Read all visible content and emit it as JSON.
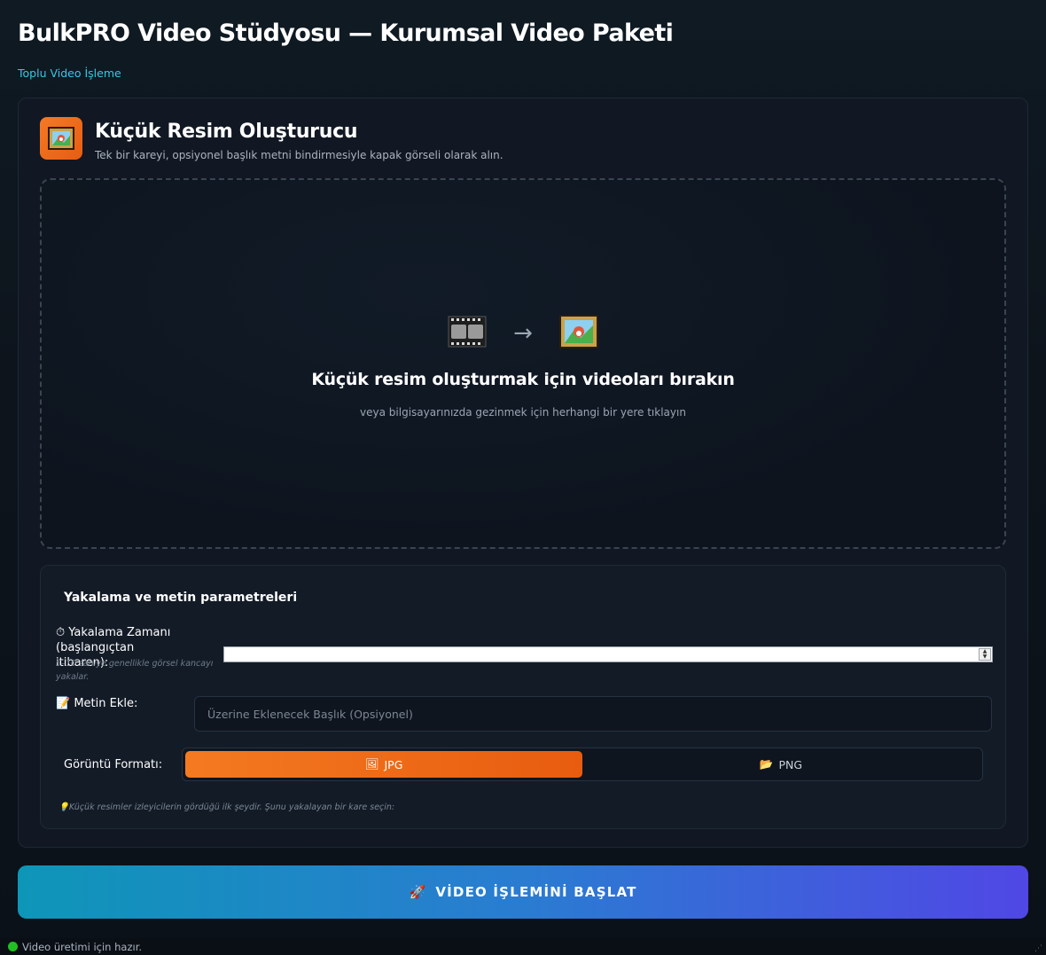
{
  "app": {
    "title": "BulkPRO Video Stüdyosu — Kurumsal Video Paketi",
    "subtitle": "Toplu Video İşleme"
  },
  "tool": {
    "icon": "framed-picture-icon",
    "title": "Küçük Resim Oluşturucu",
    "description": "Tek bir kareyi, opsiyonel başlık metni bindirmesiyle kapak görseli olarak alın."
  },
  "dropzone": {
    "arrow": "→",
    "title": "Küçük resim oluşturmak için videoları bırakın",
    "subtitle": "veya bilgisayarınızda gezinmek için herhangi bir yere tıklayın"
  },
  "params": {
    "title": "Yakalama ve metin parametreleri",
    "capture": {
      "label": "⏱ Yakalama Zamanı (başlangıçtan itibaren):",
      "hint": "5–10 saniye genellikle görsel kancayı yakalar.",
      "value": ""
    },
    "text": {
      "label": "📝 Metin Ekle:",
      "placeholder": "Üzerine Eklenecek Başlık (Opsiyonel)"
    },
    "format": {
      "label": "Görüntü Formatı:",
      "options": [
        {
          "icon": "🖼",
          "label": "JPG"
        },
        {
          "icon": "📂",
          "label": "PNG"
        }
      ],
      "selected": "JPG"
    },
    "tip": "💡Küçük resimler izleyicilerin gördüğü ilk şeydir. Şunu yakalayan bir kare seçin:"
  },
  "actions": {
    "start_icon": "🚀",
    "start_label": "VİDEO İŞLEMİNİ BAŞLAT"
  },
  "status": {
    "text": "Video üretimi için hazır.",
    "color": "#20c020"
  }
}
